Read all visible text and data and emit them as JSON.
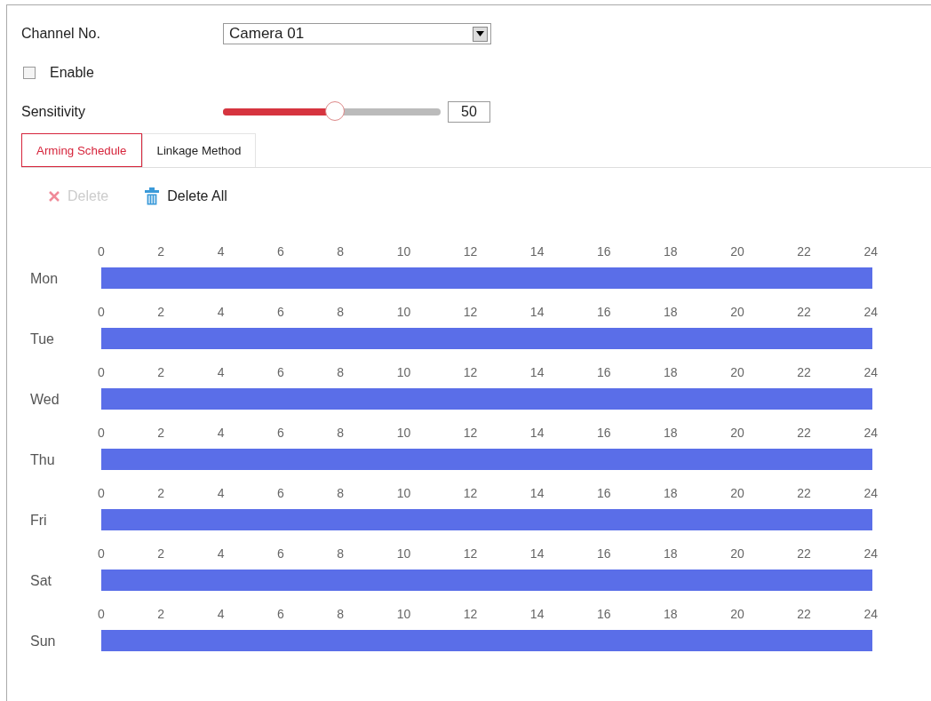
{
  "channel": {
    "label": "Channel No.",
    "value": "Camera 01"
  },
  "enable": {
    "label": "Enable",
    "checked": false
  },
  "sensitivity": {
    "label": "Sensitivity",
    "level": 0.5,
    "value": "50"
  },
  "tabs": [
    {
      "label": "Arming Schedule",
      "selected": true
    },
    {
      "label": "Linkage Method",
      "selected": false
    }
  ],
  "toolbar": [
    {
      "kind": "delete",
      "label": "Delete",
      "disabled": true
    },
    {
      "kind": "delete_all",
      "label": "Delete All",
      "disabled": false
    }
  ],
  "schedule": [
    {
      "day": "Mon",
      "level": 1,
      "ticks": [
        "0",
        "2",
        "4",
        "6",
        "8",
        "10",
        "12",
        "14",
        "16",
        "18",
        "20",
        "22",
        "24"
      ]
    },
    {
      "day": "Tue",
      "level": 1,
      "ticks": [
        "0",
        "2",
        "4",
        "6",
        "8",
        "10",
        "12",
        "14",
        "16",
        "18",
        "20",
        "22",
        "24"
      ]
    },
    {
      "day": "Wed",
      "level": 1,
      "ticks": [
        "0",
        "2",
        "4",
        "6",
        "8",
        "10",
        "12",
        "14",
        "16",
        "18",
        "20",
        "22",
        "24"
      ]
    },
    {
      "day": "Thu",
      "level": 1,
      "ticks": [
        "0",
        "2",
        "4",
        "6",
        "8",
        "10",
        "12",
        "14",
        "16",
        "18",
        "20",
        "22",
        "24"
      ]
    },
    {
      "day": "Fri",
      "level": 1,
      "ticks": [
        "0",
        "2",
        "4",
        "6",
        "8",
        "10",
        "12",
        "14",
        "16",
        "18",
        "20",
        "22",
        "24"
      ]
    },
    {
      "day": "Sat",
      "level": 1,
      "ticks": [
        "0",
        "2",
        "4",
        "6",
        "8",
        "10",
        "12",
        "14",
        "16",
        "18",
        "20",
        "22",
        "24"
      ]
    },
    {
      "day": "Sun",
      "level": 1,
      "ticks": [
        "0",
        "2",
        "4",
        "6",
        "8",
        "10",
        "12",
        "14",
        "16",
        "18",
        "20",
        "22",
        "24"
      ]
    }
  ]
}
